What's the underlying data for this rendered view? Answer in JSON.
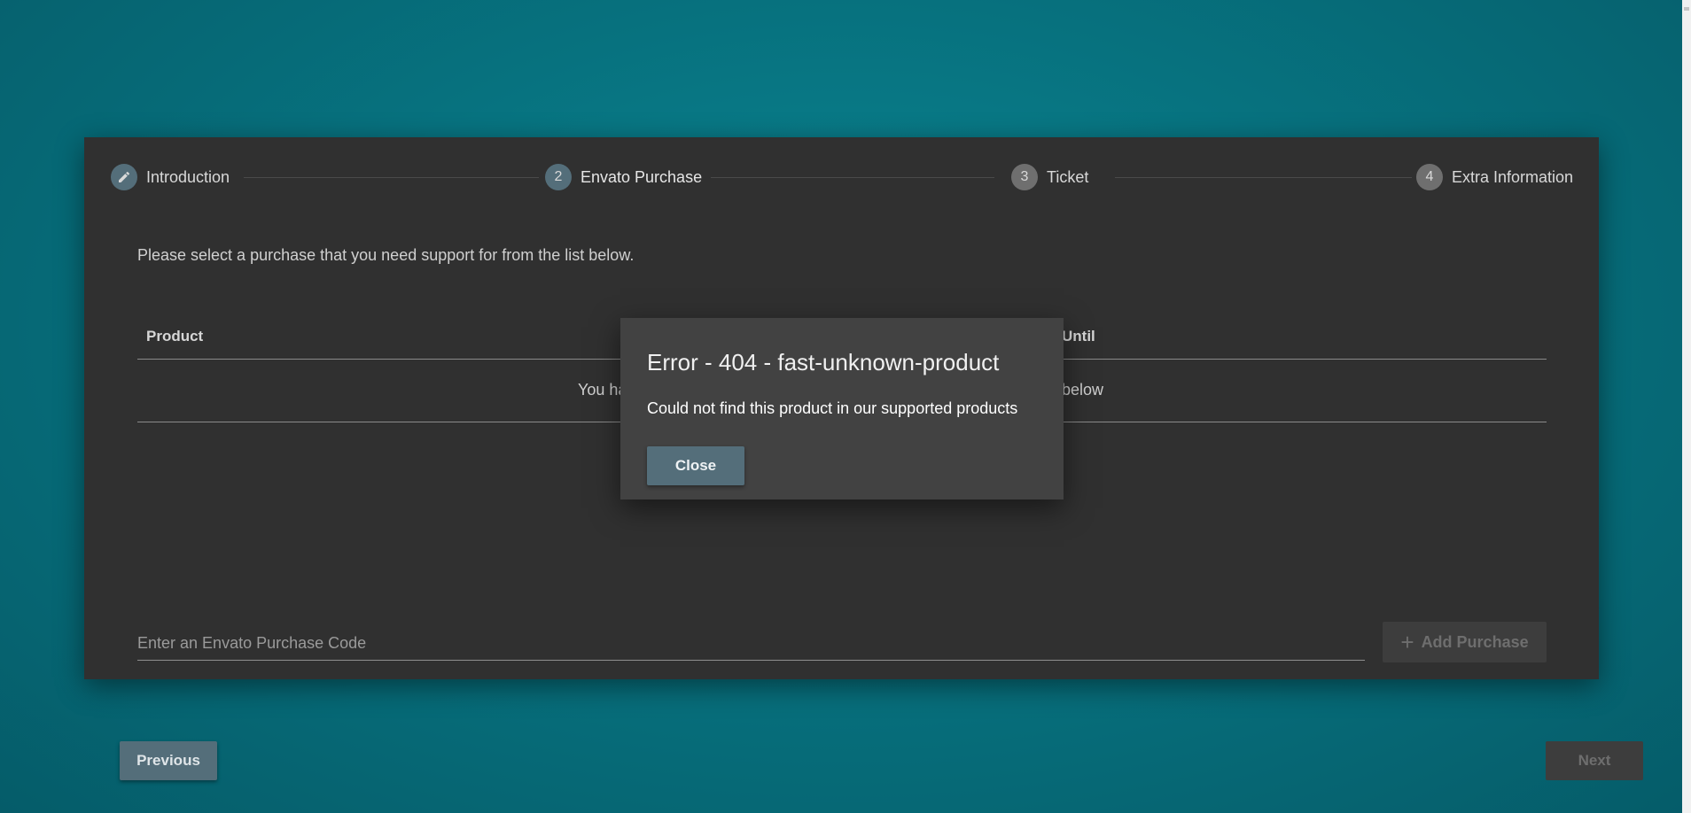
{
  "stepper": {
    "steps": [
      {
        "label": "Introduction",
        "icon": "pencil-icon"
      },
      {
        "label": "Envato Purchase",
        "number": "2"
      },
      {
        "label": "Ticket",
        "number": "3"
      },
      {
        "label": "Extra Information",
        "number": "4"
      }
    ]
  },
  "intro": {
    "text": "Please select a purchase that you need support for from the list below."
  },
  "table": {
    "columns": [
      "Product",
      "Until"
    ],
    "empty_left": "You ha",
    "empty_right": "below"
  },
  "purchase_code": {
    "placeholder": "Enter an Envato Purchase Code"
  },
  "buttons": {
    "add_purchase": "Add Purchase",
    "previous": "Previous",
    "next": "Next"
  },
  "dialog": {
    "title": "Error - 404 - fast-unknown-product",
    "message": "Could not find this product in our supported products",
    "close_label": "Close"
  },
  "colors": {
    "accent": "#546e7a",
    "card": "#303030",
    "dialog": "#424242",
    "background": "#07727f"
  }
}
